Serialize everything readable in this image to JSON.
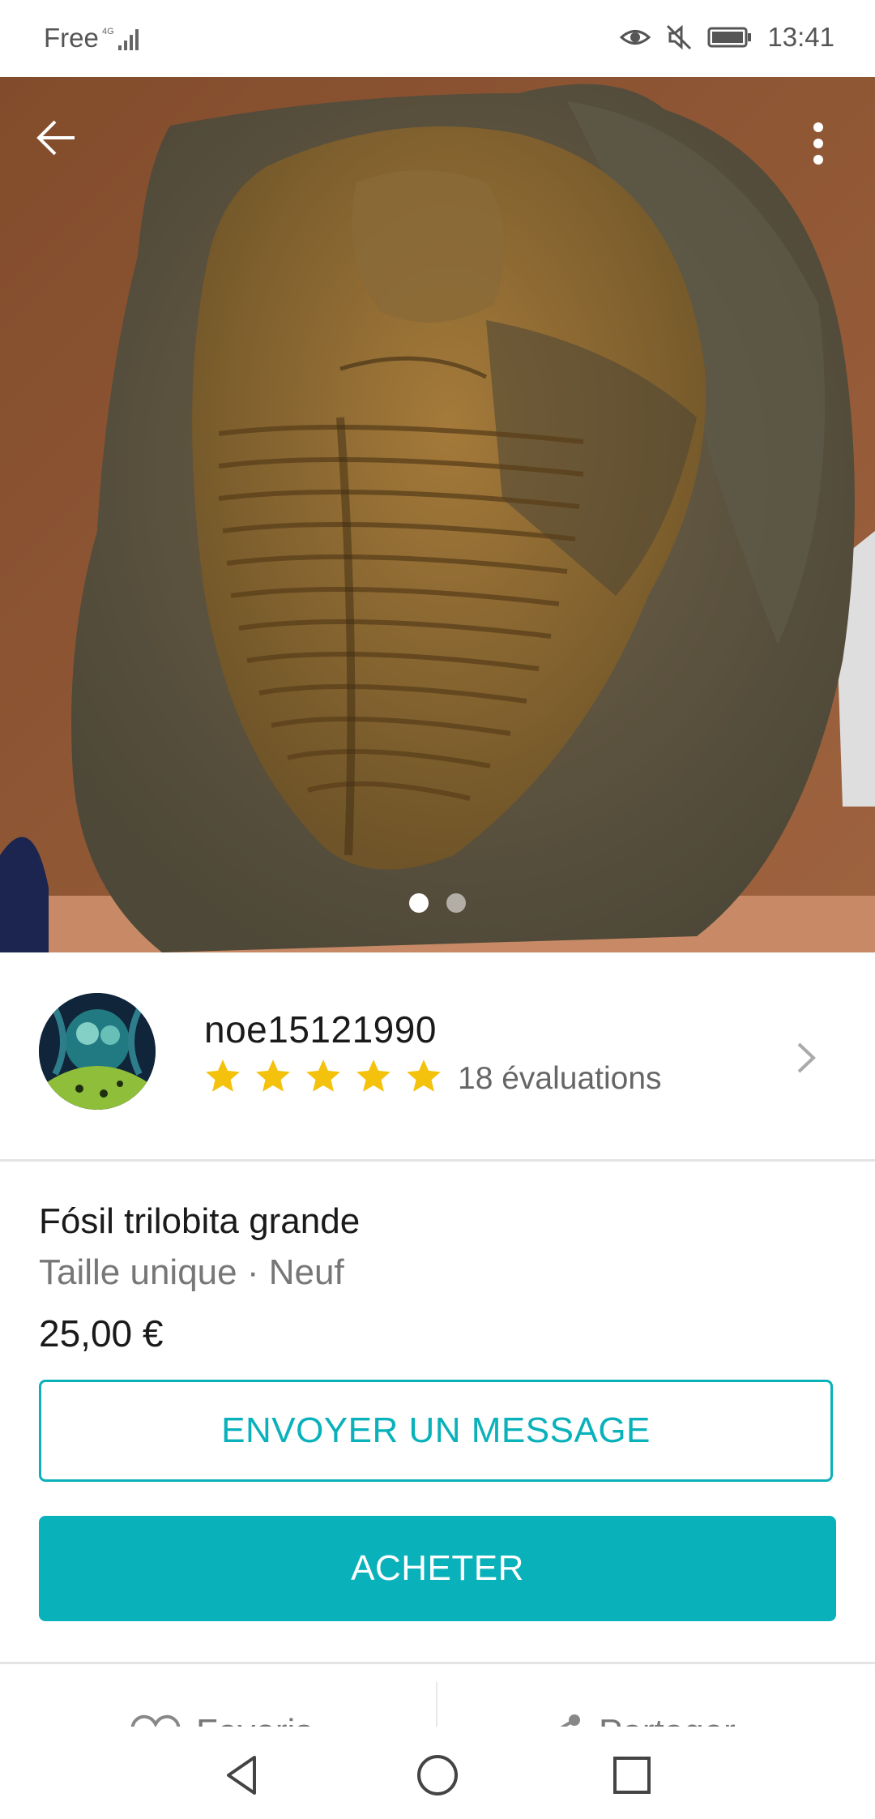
{
  "status_bar": {
    "carrier": "Free",
    "network": "4G",
    "time": "13:41"
  },
  "photo": {
    "image_count": 2,
    "current_index": 1
  },
  "seller": {
    "username": "noe15121990",
    "rating_stars": 5,
    "reviews_label": "18 évaluations"
  },
  "item": {
    "title": "Fósil trilobita grande",
    "subtitle": "Taille unique · Neuf",
    "price": "25,00 €"
  },
  "buttons": {
    "message_label": "ENVOYER UN MESSAGE",
    "buy_label": "ACHETER"
  },
  "actions": {
    "favorite_label": "Favoris",
    "share_label": "Partager"
  },
  "colors": {
    "accent": "#09b1ba",
    "star": "#f4c20d"
  },
  "icons": [
    "back-arrow-icon",
    "more-vert-icon",
    "chevron-right-icon",
    "star-icon",
    "heart-icon",
    "share-icon",
    "eye-icon",
    "mute-icon",
    "battery-icon",
    "nav-back-icon",
    "nav-home-icon",
    "nav-recents-icon"
  ]
}
